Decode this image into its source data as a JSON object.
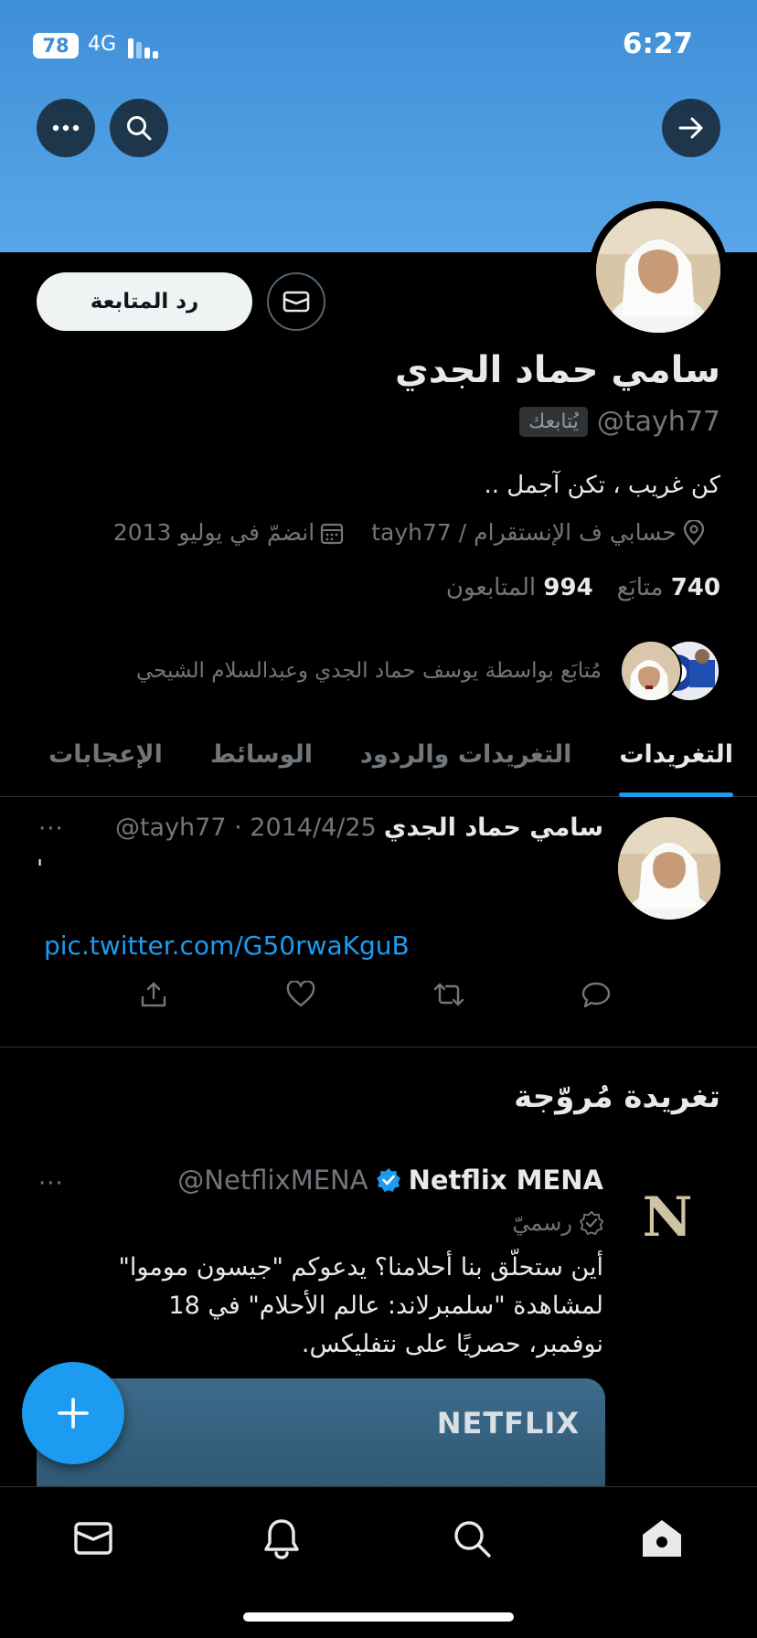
{
  "status_bar": {
    "battery": "78",
    "network": "4G",
    "time": "6:27"
  },
  "profile": {
    "name": "سامي حماد الجدي",
    "handle": "@tayh77",
    "follows_you": "يُتابعك",
    "bio": "كن غريب ، تكن آجمل ..",
    "location": "حسابي ف الإنستقرام  /  tayh77",
    "joined": "انضمّ في يوليو 2013",
    "following_count": "740",
    "following_label": "متابَع",
    "followers_count": "994",
    "followers_label": "المتابعون",
    "followed_by": "مُتابَع بواسطة يوسف حماد الجدي وعبدالسلام الشيحي",
    "follow_back_label": "رد المتابعة"
  },
  "tabs": [
    {
      "label": "التغريدات",
      "active": true
    },
    {
      "label": "التغريدات والردود",
      "active": false
    },
    {
      "label": "الوسائط",
      "active": false
    },
    {
      "label": "الإعجابات",
      "active": false
    }
  ],
  "tweet": {
    "author": "سامي حماد الجدي",
    "meta": "@tayh77 · 2014/4/25",
    "text": "'",
    "link": "pic.twitter.com/G50rwaKguB",
    "more": "···"
  },
  "promoted": {
    "section_title": "تغريدة مُروّجة",
    "logo_letter": "N",
    "name": "Netflix MENA",
    "handle": "@NetflixMENA",
    "official_label": "رسميّ",
    "text": "أين ستحلّق بنا أحلامنا؟ يدعوكم \"جيسون موموا\" لمشاهدة \"سلمبرلاند: عالم الأحلام\" في 18 نوفمبر، حصريًا على نتفليكس.",
    "card_brand": "NETFLIX",
    "more": "···"
  },
  "colors": {
    "accent": "#1d9bf0",
    "banner": "#4a9be0",
    "muted": "#71767b"
  }
}
